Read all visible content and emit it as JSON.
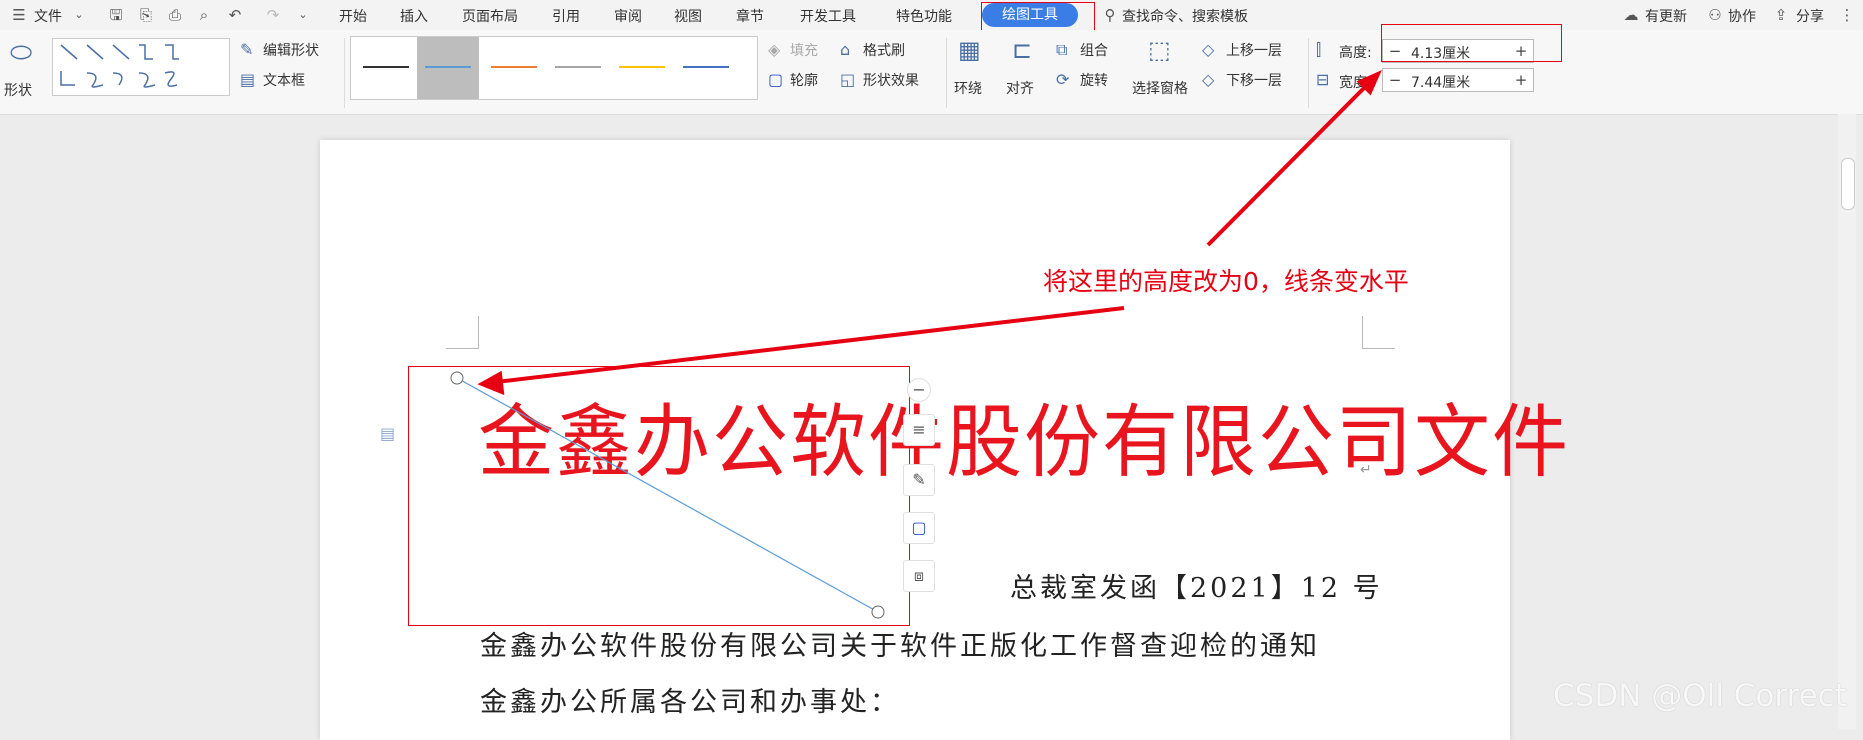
{
  "menubar": {
    "file_label": "文件",
    "tabs": [
      "开始",
      "插入",
      "页面布局",
      "引用",
      "审阅",
      "视图",
      "章节",
      "开发工具",
      "特色功能"
    ],
    "active_tab": "绘图工具",
    "search_label": "查找命令、搜索模板",
    "update_label": "有更新",
    "collab_label": "协作",
    "share_label": "分享"
  },
  "ribbon": {
    "shape_label": "形状",
    "edit_shape_label": "编辑形状",
    "textbox_label": "文本框",
    "fill_label": "填充",
    "format_brush_label": "格式刷",
    "outline_label": "轮廓",
    "shape_effect_label": "形状效果",
    "wrap_label": "环绕",
    "align_label": "对齐",
    "group_label": "组合",
    "rotate_label": "旋转",
    "selection_pane_label": "选择窗格",
    "bring_forward_label": "上移一层",
    "send_backward_label": "下移一层",
    "height_label": "高度:",
    "height_value": "4.13厘米",
    "width_label": "宽度:",
    "width_value": "7.44厘米",
    "minus": "−",
    "plus": "+"
  },
  "document": {
    "title": "金鑫办公软件股份有限公司文件",
    "doc_number": "总裁室发函【2021】12 号",
    "subject": "金鑫办公软件股份有限公司关于软件正版化工作督查迎检的通知",
    "recipient": "金鑫办公所属各公司和办事处：",
    "para_mark": "↵"
  },
  "annotation": "将这里的高度改为0，线条变水平",
  "watermark": "CSDN @Oll Correct",
  "colors": {
    "accent": "#3b7de6",
    "annotation_red": "#e60012",
    "title_red": "#e8141e"
  }
}
